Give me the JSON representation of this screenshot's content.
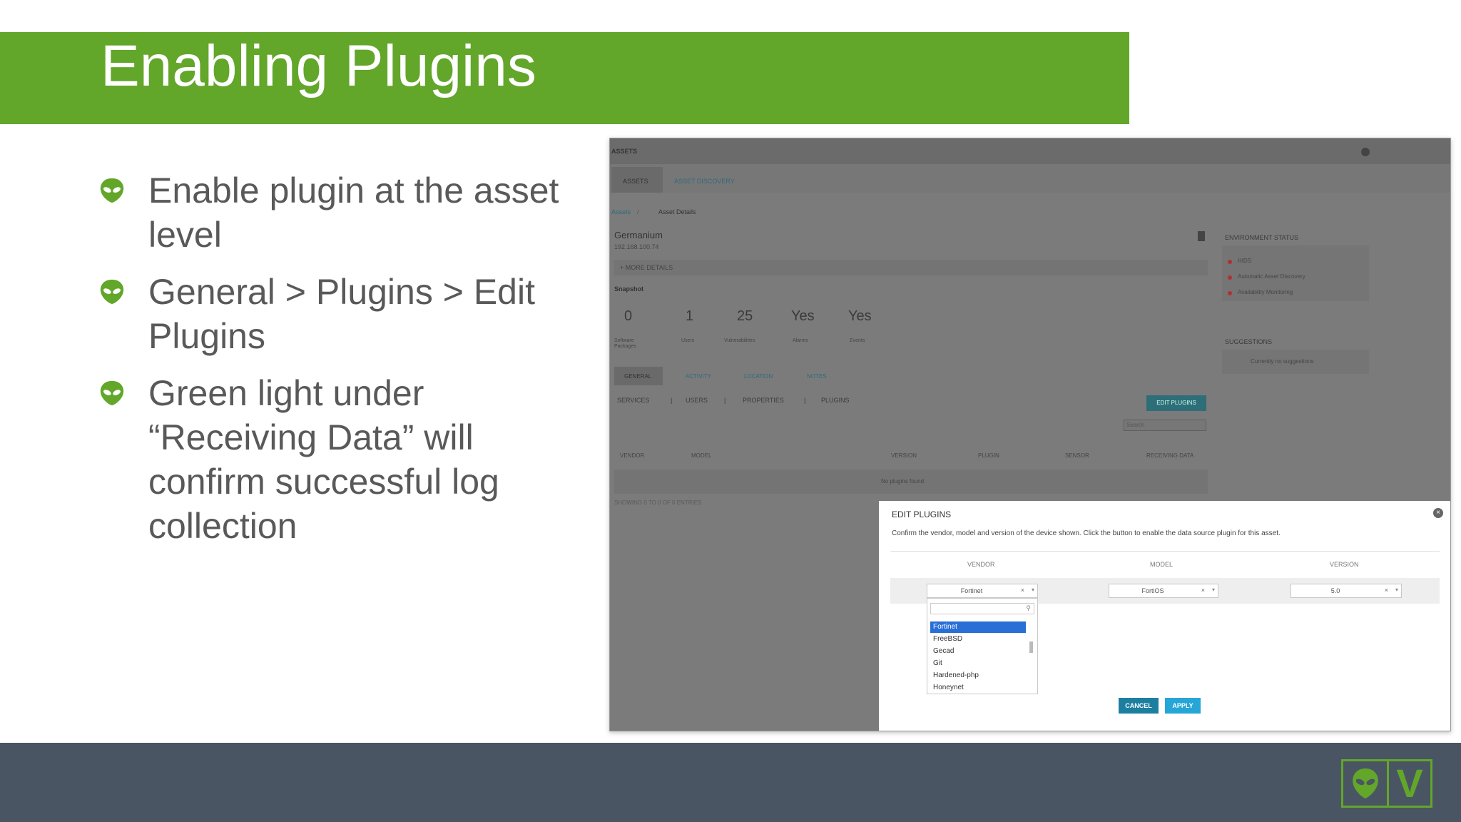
{
  "slide": {
    "title": "Enabling Plugins",
    "bullets": [
      {
        "text": "Enable plugin at the asset level"
      },
      {
        "text": "General > Plugins > Edit Plugins"
      },
      {
        "text": "Green light under “Receiving Data” will confirm successful log collection"
      }
    ],
    "bullet_icon": "alien-head-icon",
    "logo": {
      "letter": "V",
      "icon": "alien-head-icon",
      "color": "#62a62a"
    },
    "colors": {
      "title_bar": "#62a62a",
      "footer": "#4a5563",
      "bullet_text": "#595959"
    }
  },
  "screenshot": {
    "header": {
      "title": "ASSETS"
    },
    "tabs": [
      "ASSETS",
      "ASSET DISCOVERY"
    ],
    "breadcrumb": {
      "root": "Assets",
      "current": "Asset Details"
    },
    "asset": {
      "name": "Germanium",
      "ip": "192.168.100.74",
      "more_details": "+ MORE DETAILS"
    },
    "snapshot": {
      "label": "Snapshot",
      "stats": [
        {
          "value": "0",
          "label": "Software Packages"
        },
        {
          "value": "1",
          "label": "Users"
        },
        {
          "value": "25",
          "label": "Vulnerabilities"
        },
        {
          "value": "Yes",
          "label": "Alarms"
        },
        {
          "value": "Yes",
          "label": "Events"
        }
      ]
    },
    "detail_tabs": [
      "GENERAL",
      "ACTIVITY",
      "LOCATION",
      "NOTES"
    ],
    "sub_tabs": [
      "SERVICES",
      "USERS",
      "PROPERTIES",
      "PLUGINS"
    ],
    "edit_plugins_button": "EDIT PLUGINS",
    "search_placeholder": "Search",
    "table": {
      "columns": [
        "VENDOR",
        "MODEL",
        "VERSION",
        "PLUGIN",
        "SENSOR",
        "RECEIVING DATA"
      ],
      "empty": "No plugins found",
      "footer": "SHOWING 0 TO 0 OF 0 ENTRIES"
    },
    "environment": {
      "title": "ENVIRONMENT STATUS",
      "items": [
        "HIDS",
        "Automatic Asset Discovery",
        "Availability Monitoring"
      ]
    },
    "suggestions": {
      "title": "SUGGESTIONS",
      "text": "Currently no suggestions"
    },
    "modal": {
      "title": "EDIT PLUGINS",
      "description": "Confirm the vendor, model and version of the device shown. Click the button to enable the data source plugin for this asset.",
      "headers": {
        "vendor": "VENDOR",
        "model": "MODEL",
        "version": "VERSION"
      },
      "vendor_value": "Fortinet",
      "model_value": "FortiOS",
      "version_value": "5.0",
      "vendor_options": [
        "Fortinet",
        "FreeBSD",
        "Gecad",
        "Git",
        "Hardened-php",
        "Honeynet"
      ],
      "cancel": "CANCEL",
      "apply": "APPLY"
    }
  }
}
